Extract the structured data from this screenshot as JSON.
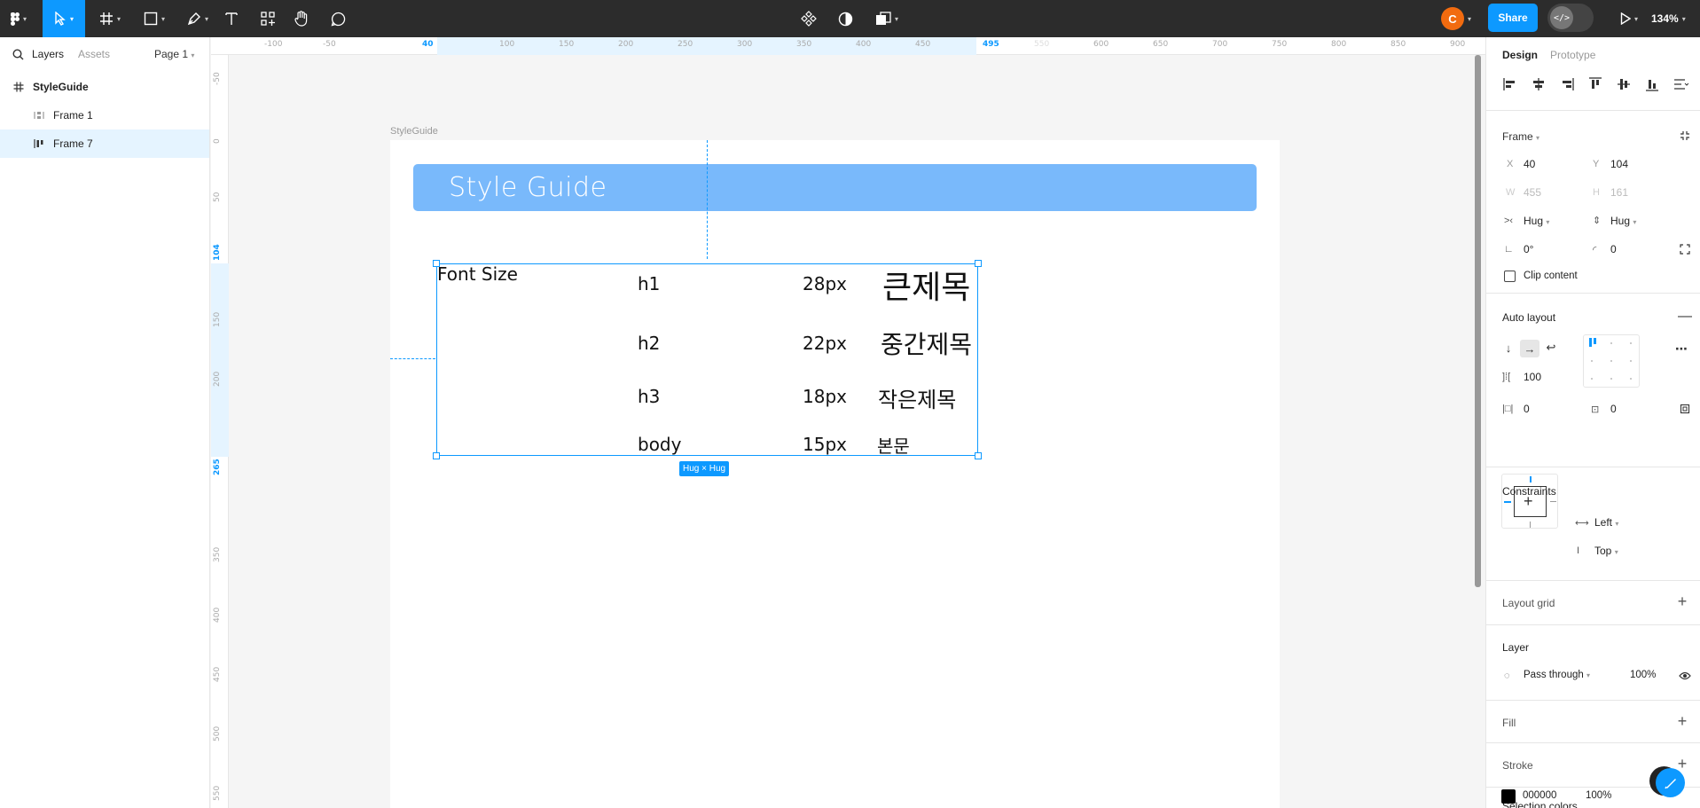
{
  "toolbar": {
    "share_label": "Share",
    "zoom_label": "134%",
    "avatar_initial": "C",
    "dev_mode_glyph": "</>"
  },
  "left_panel": {
    "tabs": [
      "Layers",
      "Assets"
    ],
    "page_selector": "Page 1",
    "layers": [
      {
        "name": "StyleGuide",
        "icon": "frame-hash-icon",
        "selected": false
      },
      {
        "name": "Frame 1",
        "icon": "auto-layout-vertical-icon",
        "selected": false
      },
      {
        "name": "Frame 7",
        "icon": "auto-layout-horizontal-icon",
        "selected": true
      }
    ]
  },
  "rulers": {
    "top_ticks": [
      "-100",
      "-50",
      "40",
      "100",
      "150",
      "200",
      "250",
      "300",
      "350",
      "400",
      "450",
      "495",
      "550",
      "600",
      "650",
      "700",
      "750",
      "800",
      "850",
      "900"
    ],
    "top_highlighted": [
      "40",
      "495"
    ],
    "left_ticks": [
      "-50",
      "0",
      "50",
      "104",
      "150",
      "200",
      "265",
      "350",
      "400",
      "450",
      "500",
      "550"
    ],
    "left_highlighted": [
      "104",
      "265"
    ]
  },
  "canvas": {
    "frame_label": "StyleGuide",
    "header_title": "Style Guide",
    "font_size_label": "Font Size",
    "rows": [
      {
        "tag": "h1",
        "size": "28px",
        "sample": "큰제목"
      },
      {
        "tag": "h2",
        "size": "22px",
        "sample": "중간제목"
      },
      {
        "tag": "h3",
        "size": "18px",
        "sample": "작은제목"
      },
      {
        "tag": "body",
        "size": "15px",
        "sample": "본문"
      }
    ],
    "hug_badge": "Hug × Hug",
    "header_color": "#79b9fb",
    "selection_color": "#0d99ff"
  },
  "right_panel": {
    "tabs": [
      "Design",
      "Prototype"
    ],
    "frame": {
      "title": "Frame",
      "x_label": "X",
      "x_value": "40",
      "y_label": "Y",
      "y_value": "104",
      "w_label": "W",
      "w_value": "455",
      "h_label": "H",
      "h_value": "161",
      "horizontal_sizing": "Hug",
      "vertical_sizing": "Hug",
      "rotation": "0°",
      "corner_radius": "0",
      "clip_content_label": "Clip content"
    },
    "auto_layout": {
      "title": "Auto layout",
      "gap": "100",
      "padding_horizontal": "0",
      "padding_vertical": "0"
    },
    "constraints": {
      "title": "Constraints",
      "horizontal": "Left",
      "vertical": "Top"
    },
    "layout_grid_title": "Layout grid",
    "layer": {
      "title": "Layer",
      "blend_mode": "Pass through",
      "opacity": "100%"
    },
    "fill_title": "Fill",
    "stroke_title": "Stroke",
    "selection_colors": {
      "title": "Selection colors",
      "hex": "000000",
      "opacity": "100%",
      "swatch_color": "#000000"
    }
  }
}
